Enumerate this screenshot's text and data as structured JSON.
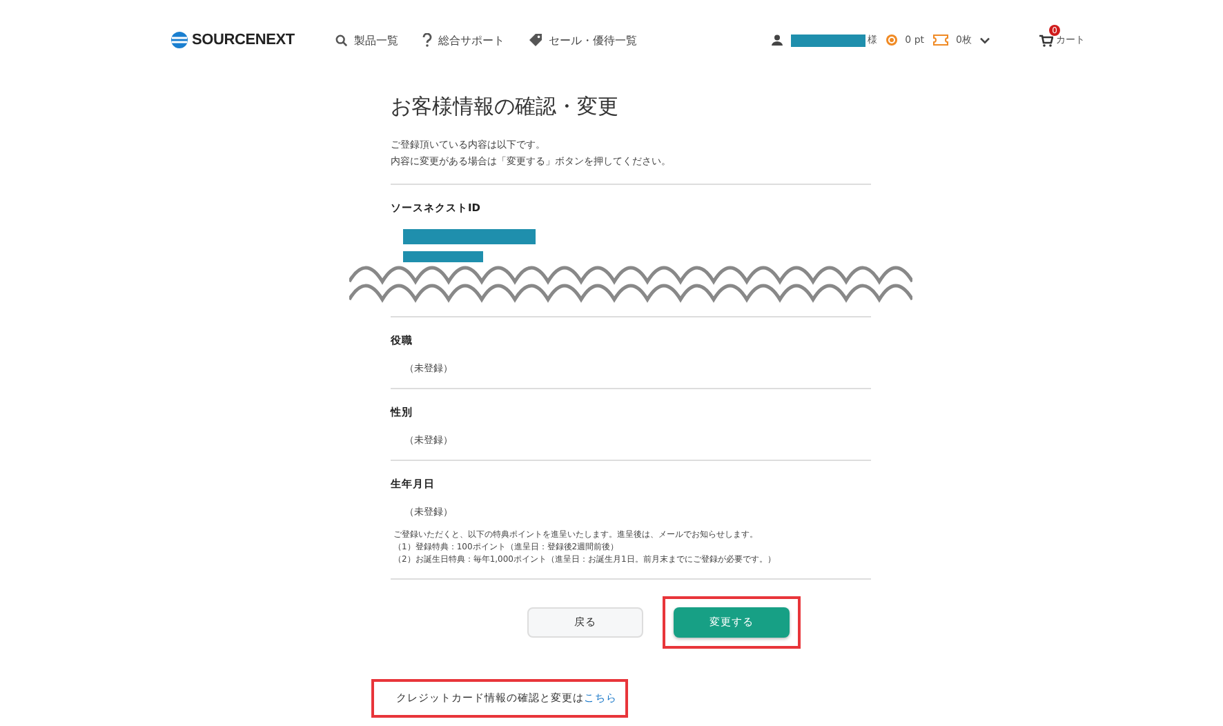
{
  "header": {
    "logo": "SOURCENEXT",
    "nav": [
      {
        "kind": "search",
        "label": "製品一覧"
      },
      {
        "kind": "help",
        "label": "総合サポート"
      },
      {
        "kind": "tag",
        "label": "セール・優待一覧"
      }
    ],
    "user_suffix": "様",
    "points": "0 pt",
    "coupons": "0枚",
    "cart_count": "0",
    "cart_label": "カート"
  },
  "page": {
    "title": "お客様情報の確認・変更",
    "intro": [
      "ご登録頂いている内容は以下です。",
      "内容に変更がある場合は「変更する」ボタンを押してください。"
    ],
    "sections": [
      {
        "label": "ソースネクストID",
        "kind": "redacted",
        "torn": true
      },
      {
        "label": "役職",
        "kind": "text",
        "value": "（未登録）"
      },
      {
        "label": "性別",
        "kind": "text",
        "value": "（未登録）"
      },
      {
        "label": "生年月日",
        "kind": "text",
        "value": "（未登録）",
        "notes": [
          "ご登録いただくと、以下の特典ポイントを進呈いたします。進呈後は、メールでお知らせします。",
          "（1）登録特典：100ポイント（進呈日：登録後2週間前後）",
          "（2）お誕生日特典：毎年1,000ポイント（進呈日：お誕生月1日。前月末までにご登録が必要です。）"
        ]
      }
    ],
    "buttons": [
      {
        "kind": "secondary",
        "label": "戻る",
        "highlighted": false
      },
      {
        "kind": "primary",
        "label": "変更する",
        "highlighted": true
      }
    ],
    "card_link": {
      "text": "クレジットカード情報の確認と変更は",
      "link": "こちら",
      "highlighted": true
    }
  }
}
